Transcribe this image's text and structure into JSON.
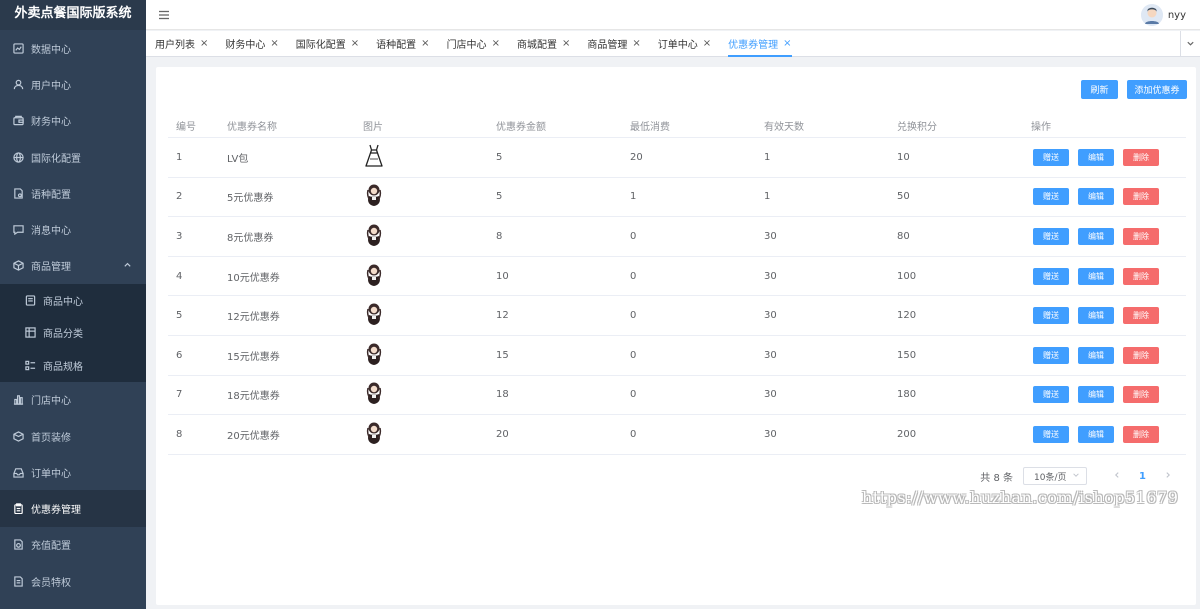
{
  "app": {
    "title": "外卖点餐国际版系统"
  },
  "sidebar": {
    "items": [
      {
        "label": "数据中心",
        "icon": "chart-line-icon"
      },
      {
        "label": "用户中心",
        "icon": "user-icon"
      },
      {
        "label": "财务中心",
        "icon": "wallet-icon"
      },
      {
        "label": "国际化配置",
        "icon": "globe-icon"
      },
      {
        "label": "语种配置",
        "icon": "document-settings-icon"
      },
      {
        "label": "消息中心",
        "icon": "message-icon"
      },
      {
        "label": "商品管理",
        "icon": "box-icon"
      },
      {
        "label": "商品中心",
        "icon": "document-icon"
      },
      {
        "label": "商品分类",
        "icon": "grid-icon"
      },
      {
        "label": "商品规格",
        "icon": "list-icon"
      },
      {
        "label": "门店中心",
        "icon": "bar-chart-icon"
      },
      {
        "label": "首页装修",
        "icon": "package-icon"
      },
      {
        "label": "订单中心",
        "icon": "inbox-icon"
      },
      {
        "label": "优惠券管理",
        "icon": "clipboard-icon"
      },
      {
        "label": "充值配置",
        "icon": "document-money-icon"
      },
      {
        "label": "会员特权",
        "icon": "file-icon"
      }
    ]
  },
  "header": {
    "username": "nyy"
  },
  "tabs": [
    {
      "label": "用户列表",
      "close": "×"
    },
    {
      "label": "财务中心",
      "close": "×"
    },
    {
      "label": "国际化配置",
      "close": "×"
    },
    {
      "label": "语种配置",
      "close": "×"
    },
    {
      "label": "门店中心",
      "close": "×"
    },
    {
      "label": "商城配置",
      "close": "×"
    },
    {
      "label": "商品管理",
      "close": "×"
    },
    {
      "label": "订单中心",
      "close": "×"
    },
    {
      "label": "优惠券管理",
      "close": "×"
    }
  ],
  "toolbar": {
    "refresh_label": "刷新",
    "add_label": "添加优惠券"
  },
  "table": {
    "headers": [
      "编号",
      "优惠券名称",
      "图片",
      "优惠券金额",
      "最低消费",
      "有效天数",
      "兑换积分",
      "操作"
    ],
    "rows": [
      [
        "1",
        "LV包",
        "",
        "5",
        "20",
        "1",
        "10"
      ],
      [
        "2",
        "5元优惠券",
        "",
        "5",
        "1",
        "1",
        "50"
      ],
      [
        "3",
        "8元优惠券",
        "",
        "8",
        "0",
        "30",
        "80"
      ],
      [
        "4",
        "10元优惠券",
        "",
        "10",
        "0",
        "30",
        "100"
      ],
      [
        "5",
        "12元优惠券",
        "",
        "12",
        "0",
        "30",
        "120"
      ],
      [
        "6",
        "15元优惠券",
        "",
        "15",
        "0",
        "30",
        "150"
      ],
      [
        "7",
        "18元优惠券",
        "",
        "18",
        "0",
        "30",
        "180"
      ],
      [
        "8",
        "20元优惠券",
        "",
        "20",
        "0",
        "30",
        "200"
      ]
    ],
    "actions": {
      "give": "赠送",
      "edit": "编辑",
      "delete": "删除"
    }
  },
  "pagination": {
    "total": "共 8 条",
    "page_size": "10条/页",
    "current_page": "1"
  },
  "watermark": "https://www.huzhan.com/ishop51679",
  "colors": {
    "sidebar": "#304156",
    "primary": "#409eff",
    "danger": "#f56c6c"
  }
}
